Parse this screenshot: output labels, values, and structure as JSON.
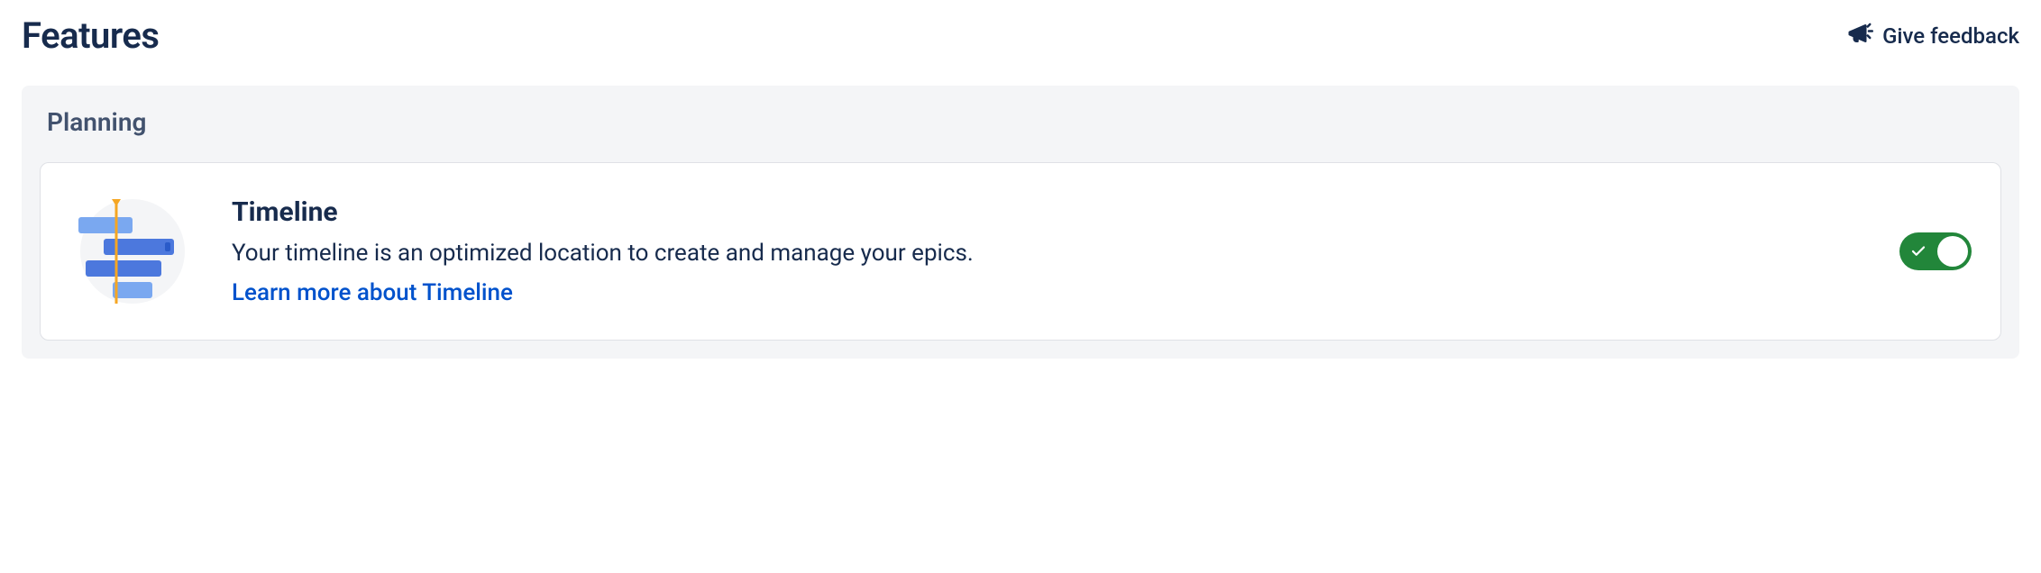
{
  "header": {
    "title": "Features",
    "feedback_label": "Give feedback"
  },
  "section": {
    "title": "Planning"
  },
  "feature": {
    "icon": "timeline-icon",
    "title": "Timeline",
    "description": "Your timeline is an optimized location to create and manage your epics.",
    "link_label": "Learn more about Timeline",
    "enabled": true,
    "colors": {
      "bar_light": "#7AA8F0",
      "bar_dark": "#4C78DD",
      "toggle_on": "#22863A",
      "link": "#0052CC"
    }
  }
}
